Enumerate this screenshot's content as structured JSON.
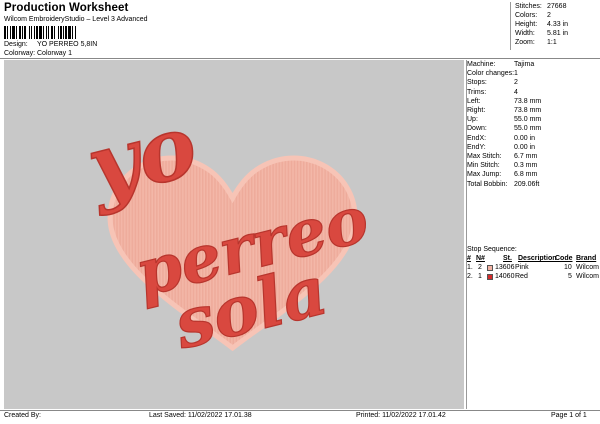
{
  "header": {
    "title": "Production Worksheet",
    "software": "Wilcom EmbroideryStudio – Level 3 Advanced",
    "design_label": "Design:",
    "design_value": "YO PERREO 5,8IN",
    "colorway_label": "Colorway:",
    "colorway_value": "Colorway 1"
  },
  "stats": [
    {
      "label": "Stitches:",
      "value": "27668"
    },
    {
      "label": "Colors:",
      "value": "2"
    },
    {
      "label": "Height:",
      "value": "4.33 in"
    },
    {
      "label": "Width:",
      "value": "5.81 in"
    },
    {
      "label": "Zoom:",
      "value": "1:1"
    }
  ],
  "design_text": {
    "line1": "yo",
    "line2": "perreo",
    "line3": "sola"
  },
  "colors": {
    "text_red": "#d9483f",
    "text_dark": "#b8352d",
    "heart_fill": "#f3b7a8",
    "heart_stroke": "#f0a893",
    "canvas_bg": "#c8c8c8"
  },
  "details": [
    {
      "label": "Machine:",
      "value": "Tajima"
    },
    {
      "label": "Color changes:",
      "value": "1"
    },
    {
      "label": "Stops:",
      "value": "2"
    },
    {
      "label": "Trims:",
      "value": "4"
    },
    {
      "label": "Left:",
      "value": "73.8 mm"
    },
    {
      "label": "Right:",
      "value": "73.8 mm"
    },
    {
      "label": "Up:",
      "value": "55.0 mm"
    },
    {
      "label": "Down:",
      "value": "55.0 mm"
    },
    {
      "label": "EndX:",
      "value": "0.00 in"
    },
    {
      "label": "EndY:",
      "value": "0.00 in"
    },
    {
      "label": "Max Stitch:",
      "value": "6.7 mm"
    },
    {
      "label": "Min Stitch:",
      "value": "0.3 mm"
    },
    {
      "label": "Max Jump:",
      "value": "6.8 mm"
    },
    {
      "label": "Total Bobbin:",
      "value": "209.06ft"
    }
  ],
  "stop_sequence": {
    "label": "Stop Sequence:",
    "columns": [
      "#",
      "N#",
      "St.",
      "Description",
      "Code",
      "Brand"
    ],
    "rows": [
      {
        "num": "1.",
        "needle": "2",
        "st": "13606",
        "desc": "Pink",
        "code": "10",
        "brand": "Wilcom",
        "color": "#f2b3a4"
      },
      {
        "num": "2.",
        "needle": "1",
        "st": "14060",
        "desc": "Red",
        "code": "5",
        "brand": "Wilcom",
        "color": "#d42a2a"
      }
    ]
  },
  "footer": {
    "created_by": "Created By:",
    "last_saved": "Last Saved: 11/02/2022 17.01.38",
    "printed": "Printed: 11/02/2022 17.01.42",
    "page": "Page 1 of 1"
  }
}
